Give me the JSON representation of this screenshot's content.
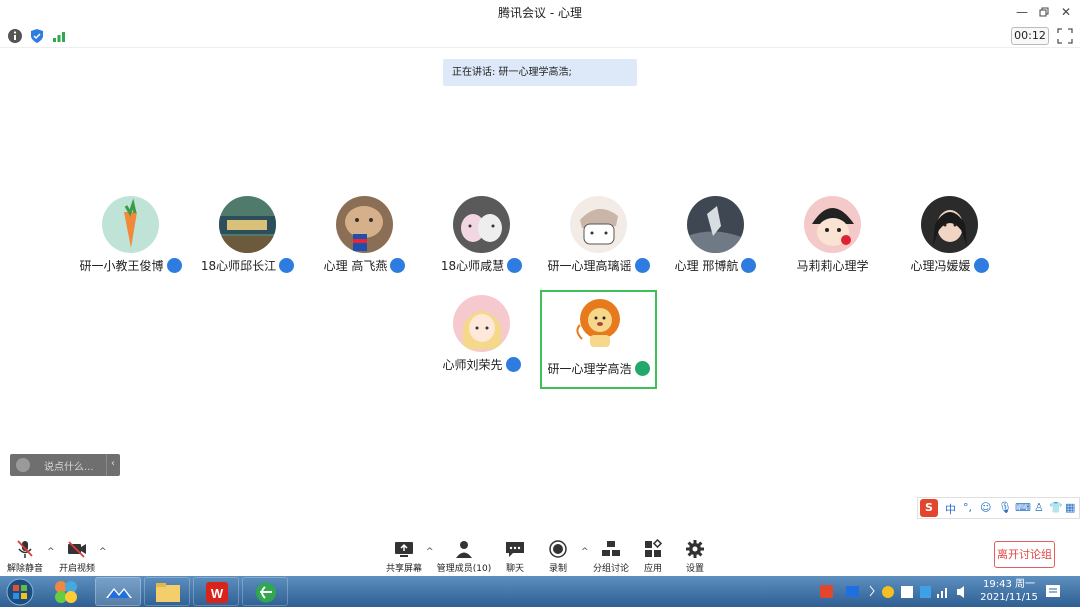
{
  "window": {
    "title": "腾讯会议 - 心理"
  },
  "status": {
    "timer": "00:12"
  },
  "banner": {
    "speaking": "正在讲话: 研一心理学高浩;"
  },
  "participants": [
    {
      "name": "研一小教王俊博",
      "mic": "on"
    },
    {
      "name": "18心师邱长江",
      "mic": "on"
    },
    {
      "name": "心理 高飞燕",
      "mic": "on"
    },
    {
      "name": "18心师咸慧",
      "mic": "on"
    },
    {
      "name": "研一心理高璃谣",
      "mic": "on"
    },
    {
      "name": "心理 邢博航",
      "mic": "on"
    },
    {
      "name": "马莉莉心理学",
      "mic": "none"
    },
    {
      "name": "心理冯媛媛",
      "mic": "on"
    },
    {
      "name": "心师刘荣先",
      "mic": "on"
    },
    {
      "name": "研一心理学高浩",
      "mic": "speaking"
    }
  ],
  "chat": {
    "placeholder": "说点什么..."
  },
  "ime": {
    "label": "中"
  },
  "toolbar": {
    "unmute": "解除静音",
    "video": "开启视频",
    "share": "共享屏幕",
    "members": "管理成员(10)",
    "chat": "聊天",
    "record": "录制",
    "breakout": "分组讨论",
    "apps": "应用",
    "settings": "设置",
    "leave": "离开讨论组"
  },
  "taskbar": {
    "time": "19:43 周一",
    "date": "2021/11/15"
  }
}
